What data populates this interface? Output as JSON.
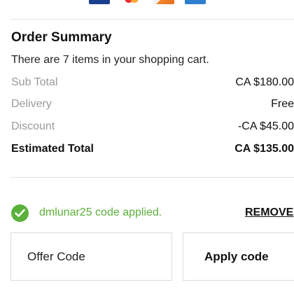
{
  "payment_cards": [
    "visa-card-icon",
    "mastercard-icon",
    "discover-card-icon",
    "amex-card-icon"
  ],
  "summary": {
    "title": "Order Summary",
    "item_count_text": "There are 7 items in your shopping cart.",
    "rows": [
      {
        "label": "Sub Total",
        "value": "CA $180.00"
      },
      {
        "label": "Delivery",
        "value": "Free"
      },
      {
        "label": "Discount",
        "value": "-CA $45.00"
      }
    ],
    "total": {
      "label": "Estimated Total",
      "value": "CA $135.00"
    }
  },
  "promo": {
    "applied_text": "dmlunar25 code applied.",
    "remove_label": "REMOVE",
    "offer_placeholder": "Offer Code",
    "offer_value": "",
    "apply_label": "Apply code"
  },
  "colors": {
    "success_green": "#5ab03a",
    "muted_label": "#9a9a9a",
    "divider": "#e4e4e4"
  }
}
